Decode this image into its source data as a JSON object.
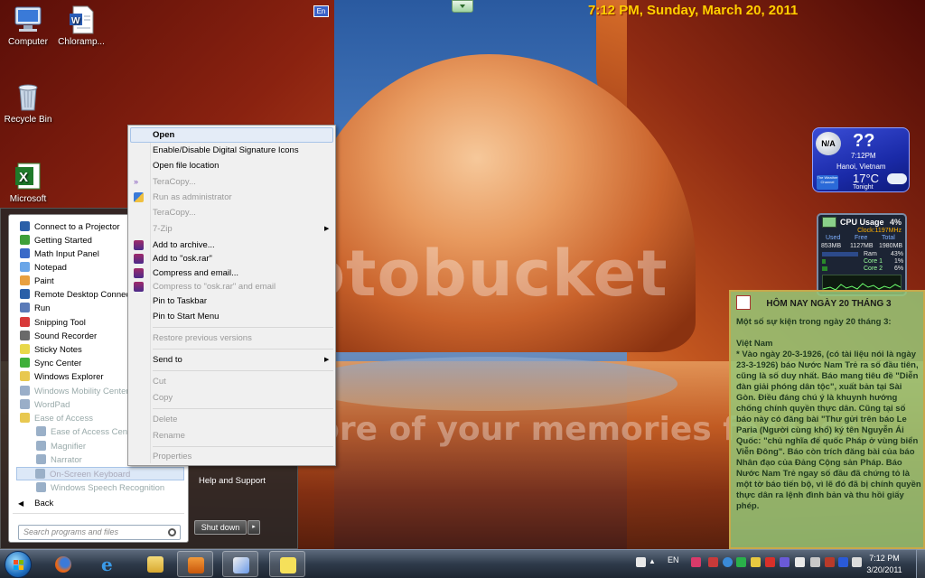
{
  "desktop": {
    "icons": [
      {
        "label": "Computer"
      },
      {
        "label": "Chloramp..."
      },
      {
        "label": "Recycle Bin"
      },
      {
        "label": "Microsoft"
      }
    ],
    "lang_indicator": "En",
    "clock_banner": "7:12 PM, Sunday, March 20, 2011",
    "watermark_logo": "photobucket",
    "watermark_slogan": "Protect more of your memories for less!"
  },
  "weather": {
    "status": "N/A",
    "condition": "??",
    "time": "7:12PM",
    "city": "Hanoi, Vietnam",
    "temperature": "17°C",
    "period": "Tonight",
    "channel": "The Weather Channel"
  },
  "cpu_meter": {
    "title": "CPU Usage",
    "total_pct": "4%",
    "clock": "Clock:1197MHz",
    "headers": {
      "used": "Used",
      "free": "Free",
      "total": "Total"
    },
    "used": "853MB",
    "free": "1127MB",
    "total": "1980MB",
    "ram_label": "Ram",
    "ram_pct": "43%",
    "core1_label": "Core 1",
    "core1_pct": "1%",
    "core2_label": "Core 2",
    "core2_pct": "6%"
  },
  "news_gadget": {
    "title": "HÔM NAY NGÀY  20 THÁNG 3",
    "body": "Một số sự kiện trong ngày 20 tháng 3:\n\nViệt Nam\n* Vào ngày 20-3-1926, (có tài liệu nói là ngày 23-3-1926) báo Nước Nam Trẻ ra số đầu tiên, cũng là số duy nhất. Báo mang tiêu đề \"Diễn đàn giải phóng dân tộc\", xuất bản tại Sài Gòn. Điều đáng chú ý là khuynh hướng chống chính quyền thực dân. Cũng tại số báo này có đăng bài \"Thư gửi trên báo Le Paria (Người cùng khổ) ký tên Nguyễn Ái Quốc: \"chủ nghĩa đế quốc Pháp ở vùng biển Viễn Đông\". Báo còn trích đăng bài của báo Nhân đạo của Đảng Cộng sản Pháp. Báo Nước Nam Trẻ ngay số đầu đã chứng tỏ là một tờ báo tiến bộ, vì lẽ đó đã bị chính quyền thực dân ra lệnh đình bản và thu hồi giấy phép."
  },
  "start_menu": {
    "items": [
      {
        "label": "Connect to a Projector",
        "color": "#2a5fa8"
      },
      {
        "label": "Getting Started",
        "color": "#3fa03a"
      },
      {
        "label": "Math Input Panel",
        "color": "#3a6ac8"
      },
      {
        "label": "Notepad",
        "color": "#6aa6e8"
      },
      {
        "label": "Paint",
        "color": "#e8a040"
      },
      {
        "label": "Remote Desktop Connection",
        "color": "#2a5fa8"
      },
      {
        "label": "Run",
        "color": "#5a7ab8"
      },
      {
        "label": "Snipping Tool",
        "color": "#d83a3a"
      },
      {
        "label": "Sound Recorder",
        "color": "#6a6a6a"
      },
      {
        "label": "Sticky Notes",
        "color": "#e8d84a"
      },
      {
        "label": "Sync Center",
        "color": "#3fb03a"
      },
      {
        "label": "Windows Explorer",
        "color": "#e8c850"
      },
      {
        "label": "Windows Mobility Center",
        "color": "#9aaec8"
      },
      {
        "label": "WordPad",
        "color": "#9aaec8"
      },
      {
        "label": "Ease of Access",
        "color": "#e8c850"
      }
    ],
    "sub_items": [
      {
        "label": "Ease of Access Center",
        "color": "#9ab0c8"
      },
      {
        "label": "Magnifier",
        "color": "#9ab0c8"
      },
      {
        "label": "Narrator",
        "color": "#9ab0c8"
      },
      {
        "label": "On-Screen Keyboard",
        "color": "#9ab0c8"
      },
      {
        "label": "Windows Speech Recognition",
        "color": "#9ab0c8"
      }
    ],
    "back": "Back",
    "search_placeholder": "Search programs and files",
    "help": "Help and Support",
    "shutdown": "Shut down",
    "shutdown_arrow": "▸"
  },
  "context_menu": {
    "items": [
      {
        "label": "Open"
      },
      {
        "label": "Enable/Disable Digital Signature Icons"
      },
      {
        "label": "Open file location"
      },
      {
        "label": "TeraCopy..."
      },
      {
        "label": "Run as administrator"
      },
      {
        "label": "TeraCopy..."
      },
      {
        "label": "7-Zip"
      },
      {
        "label": "Add to archive..."
      },
      {
        "label": "Add to \"osk.rar\""
      },
      {
        "label": "Compress and email..."
      },
      {
        "label": "Compress to \"osk.rar\" and email"
      },
      {
        "label": "Pin to Taskbar"
      },
      {
        "label": "Pin to Start Menu"
      },
      {
        "label": "Restore previous versions"
      },
      {
        "label": "Send to"
      },
      {
        "label": "Cut"
      },
      {
        "label": "Copy"
      },
      {
        "label": "Delete"
      },
      {
        "label": "Rename"
      },
      {
        "label": "Properties"
      }
    ]
  },
  "taskbar": {
    "tray_lang": "EN",
    "time": "7:12 PM",
    "date": "3/20/2011"
  }
}
